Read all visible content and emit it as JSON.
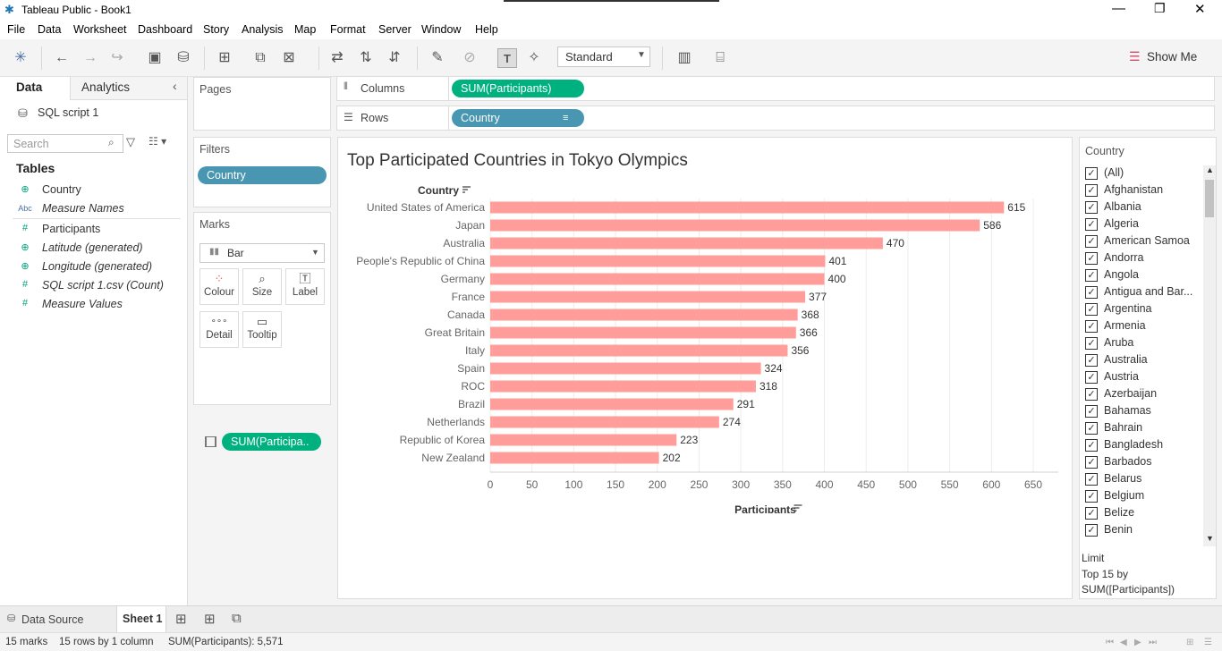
{
  "window": {
    "title": "Tableau Public - Book1"
  },
  "menu": [
    "File",
    "Data",
    "Worksheet",
    "Dashboard",
    "Story",
    "Analysis",
    "Map",
    "Format",
    "Server",
    "Window",
    "Help"
  ],
  "toolbar": {
    "fit": "Standard",
    "show_me": "Show Me"
  },
  "left_pane": {
    "tab_data": "Data",
    "tab_analytics": "Analytics",
    "datasource": "SQL script 1",
    "search_placeholder": "Search",
    "tables_title": "Tables",
    "fields": [
      {
        "name": "Country",
        "type": "geo",
        "italic": false
      },
      {
        "name": "Measure Names",
        "type": "abc",
        "italic": true
      },
      {
        "name": "Participants",
        "type": "num",
        "italic": false
      },
      {
        "name": "Latitude (generated)",
        "type": "geo",
        "italic": true
      },
      {
        "name": "Longitude (generated)",
        "type": "geo",
        "italic": true
      },
      {
        "name": "SQL script 1.csv (Count)",
        "type": "num",
        "italic": true
      },
      {
        "name": "Measure Values",
        "type": "num",
        "italic": true
      }
    ]
  },
  "cards": {
    "pages": "Pages",
    "filters": "Filters",
    "filter_pill": "Country",
    "marks": "Marks",
    "mark_type": "Bar",
    "buttons": [
      "Colour",
      "Size",
      "Label",
      "Detail",
      "Tooltip"
    ],
    "mark_pill": "SUM(Participa.."
  },
  "shelves": {
    "columns_label": "Columns",
    "columns_pill": "SUM(Participants)",
    "rows_label": "Rows",
    "rows_pill": "Country"
  },
  "chart_data": {
    "type": "bar",
    "orientation": "horizontal",
    "title": "Top Participated Countries in Tokyo Olympics",
    "categories": [
      "United States of America",
      "Japan",
      "Australia",
      "People's Republic of China",
      "Germany",
      "France",
      "Canada",
      "Great Britain",
      "Italy",
      "Spain",
      "ROC",
      "Brazil",
      "Netherlands",
      "Republic of Korea",
      "New Zealand"
    ],
    "values": [
      615,
      586,
      470,
      401,
      400,
      377,
      368,
      366,
      356,
      324,
      318,
      291,
      274,
      223,
      202
    ],
    "xlabel": "Participants",
    "ylabel": "Country",
    "xlim": [
      0,
      680
    ],
    "ticks": [
      0,
      50,
      100,
      150,
      200,
      250,
      300,
      350,
      400,
      450,
      500,
      550,
      600,
      650
    ],
    "bar_color": "#ff9d9a",
    "grid": true
  },
  "legend": {
    "title": "Country",
    "items": [
      "(All)",
      "Afghanistan",
      "Albania",
      "Algeria",
      "American Samoa",
      "Andorra",
      "Angola",
      "Antigua and Bar...",
      "Argentina",
      "Armenia",
      "Aruba",
      "Australia",
      "Austria",
      "Azerbaijan",
      "Bahamas",
      "Bahrain",
      "Bangladesh",
      "Barbados",
      "Belarus",
      "Belgium",
      "Belize",
      "Benin"
    ],
    "limit_title": "Limit",
    "limit_line1": "Top 15 by",
    "limit_line2": "SUM([Participants])"
  },
  "tabs": {
    "datasource": "Data Source",
    "sheet": "Sheet 1"
  },
  "status": {
    "marks": "15 marks",
    "rows": "15 rows  by  1 column",
    "sum": "SUM(Participants): 5,571"
  },
  "colors": {
    "green_pill": "#00b180",
    "blue_pill": "#4996b2",
    "bar": "#ff9d9a"
  }
}
